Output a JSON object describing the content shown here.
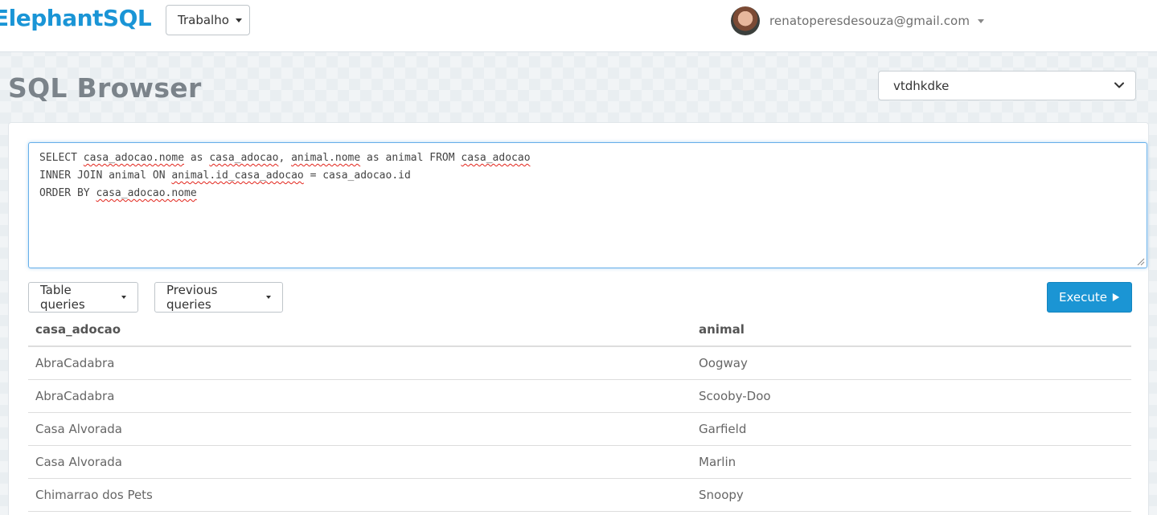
{
  "brand": {
    "name": "ElephantSQL"
  },
  "team_menu": {
    "label": "Trabalho"
  },
  "user": {
    "email": "renatoperesdesouza@gmail.com"
  },
  "page": {
    "title": "SQL Browser"
  },
  "database_select": {
    "value": "vtdhkdke"
  },
  "query": {
    "lines": [
      "SELECT casa_adocao.nome as casa_adocao, animal.nome as animal FROM casa_adocao",
      "INNER JOIN animal ON animal.id_casa_adocao = casa_adocao.id",
      "ORDER BY casa_adocao.nome"
    ]
  },
  "toolbar": {
    "table_queries_label": "Table queries",
    "previous_queries_label": "Previous queries",
    "execute_label": "Execute"
  },
  "results": {
    "columns": [
      "casa_adocao",
      "animal"
    ],
    "rows": [
      [
        "AbraCadabra",
        "Oogway"
      ],
      [
        "AbraCadabra",
        "Scooby-Doo"
      ],
      [
        "Casa Alvorada",
        "Garfield"
      ],
      [
        "Casa Alvorada",
        "Marlin"
      ],
      [
        "Chimarrao dos Pets",
        "Snoopy"
      ]
    ]
  },
  "colors": {
    "brand": "#1a95d6",
    "execute_button": "#1b95d4",
    "focus_border": "#66afe9",
    "spellcheck_underline": "#e2231a"
  },
  "icons": [
    "chevron-down-icon",
    "play-icon",
    "resize-handle-icon",
    "avatar"
  ]
}
